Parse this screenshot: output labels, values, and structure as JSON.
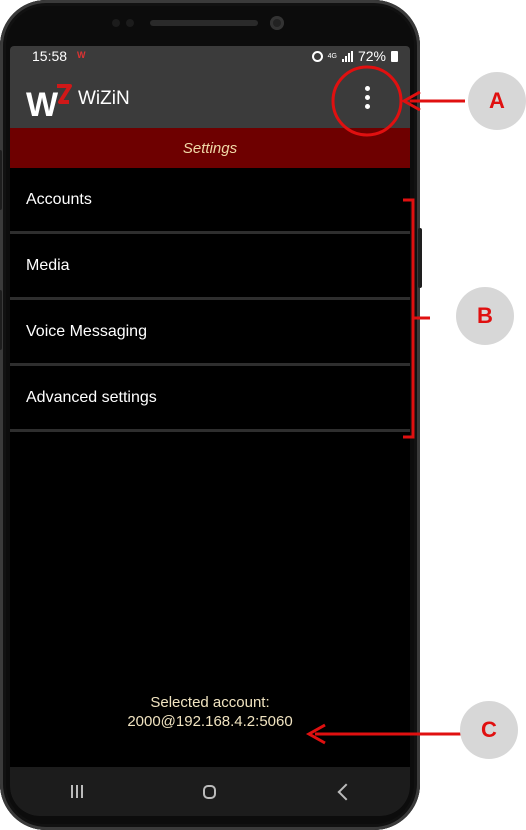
{
  "status_bar": {
    "time": "15:58",
    "app_icon": "W",
    "network": "4G",
    "battery": "72%"
  },
  "app_bar": {
    "title": "WiZiN",
    "logo_letter": "W",
    "menu_icon": "overflow-menu-icon"
  },
  "settings_header": "Settings",
  "menu_items": [
    {
      "label": "Accounts"
    },
    {
      "label": "Media"
    },
    {
      "label": "Voice Messaging"
    },
    {
      "label": "Advanced settings"
    }
  ],
  "footer": {
    "label": "Selected account:",
    "account": "2000@192.168.4.2:5060"
  },
  "nav_bar": [
    "recents-icon",
    "home-icon",
    "back-icon"
  ],
  "annotations": {
    "a": "A",
    "b": "B",
    "c": "C"
  },
  "colors": {
    "accent": "#6e0000",
    "annotation": "#e01010",
    "footer_text": "#f0e3c0"
  }
}
